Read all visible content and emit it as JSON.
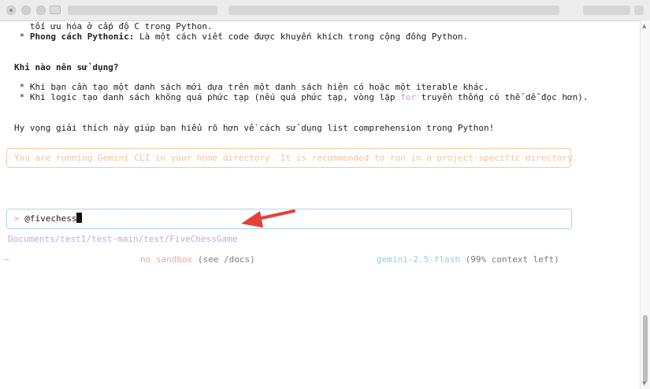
{
  "window": {
    "title_blurred": true
  },
  "content": {
    "line1": "   tối ưu hóa ở cấp độ C trong Python.",
    "bullet_pythonic": {
      "marker": " * ",
      "label": "Phong cách Pythonic:",
      "text": " Là một cách viết code được khuyến khích trong cộng đồng Python."
    },
    "heading_when": "Khi nào nên sử dụng?",
    "bullet_when_1": " * Khi bạn cần tạo một danh sách mới dựa trên một danh sách hiện có hoặc một iterable khác.",
    "bullet_when_2": {
      "before": " * Khi logic tạo danh sách không quá phức tạp (nếu quá phức tạp, vòng lặp ",
      "keyword": "for",
      "after": " truyền thống có thể dễ đọc hơn)."
    },
    "closing": "Hy vọng giải thích này giúp bạn hiểu rõ hơn về cách sử dụng list comprehension trong Python!"
  },
  "warning": {
    "text": "You are running Gemini CLI in your home directory. It is recommended to run in a project-specific directory."
  },
  "input": {
    "prompt": "> ",
    "value": "@fivechess"
  },
  "footer": {
    "path": "Documents/test1/test-main/test/FiveChessGame",
    "home": "~",
    "sandbox": "no sandbox",
    "sandbox_hint": " (see /docs)",
    "model": "gemini-2.5-flash",
    "context": " (99% context left)"
  },
  "colors": {
    "accent_purple": "#c89ee0",
    "warning_orange": "#f6c39a",
    "input_border": "#a9d6ee",
    "annotation_arrow": "#e5413a"
  }
}
